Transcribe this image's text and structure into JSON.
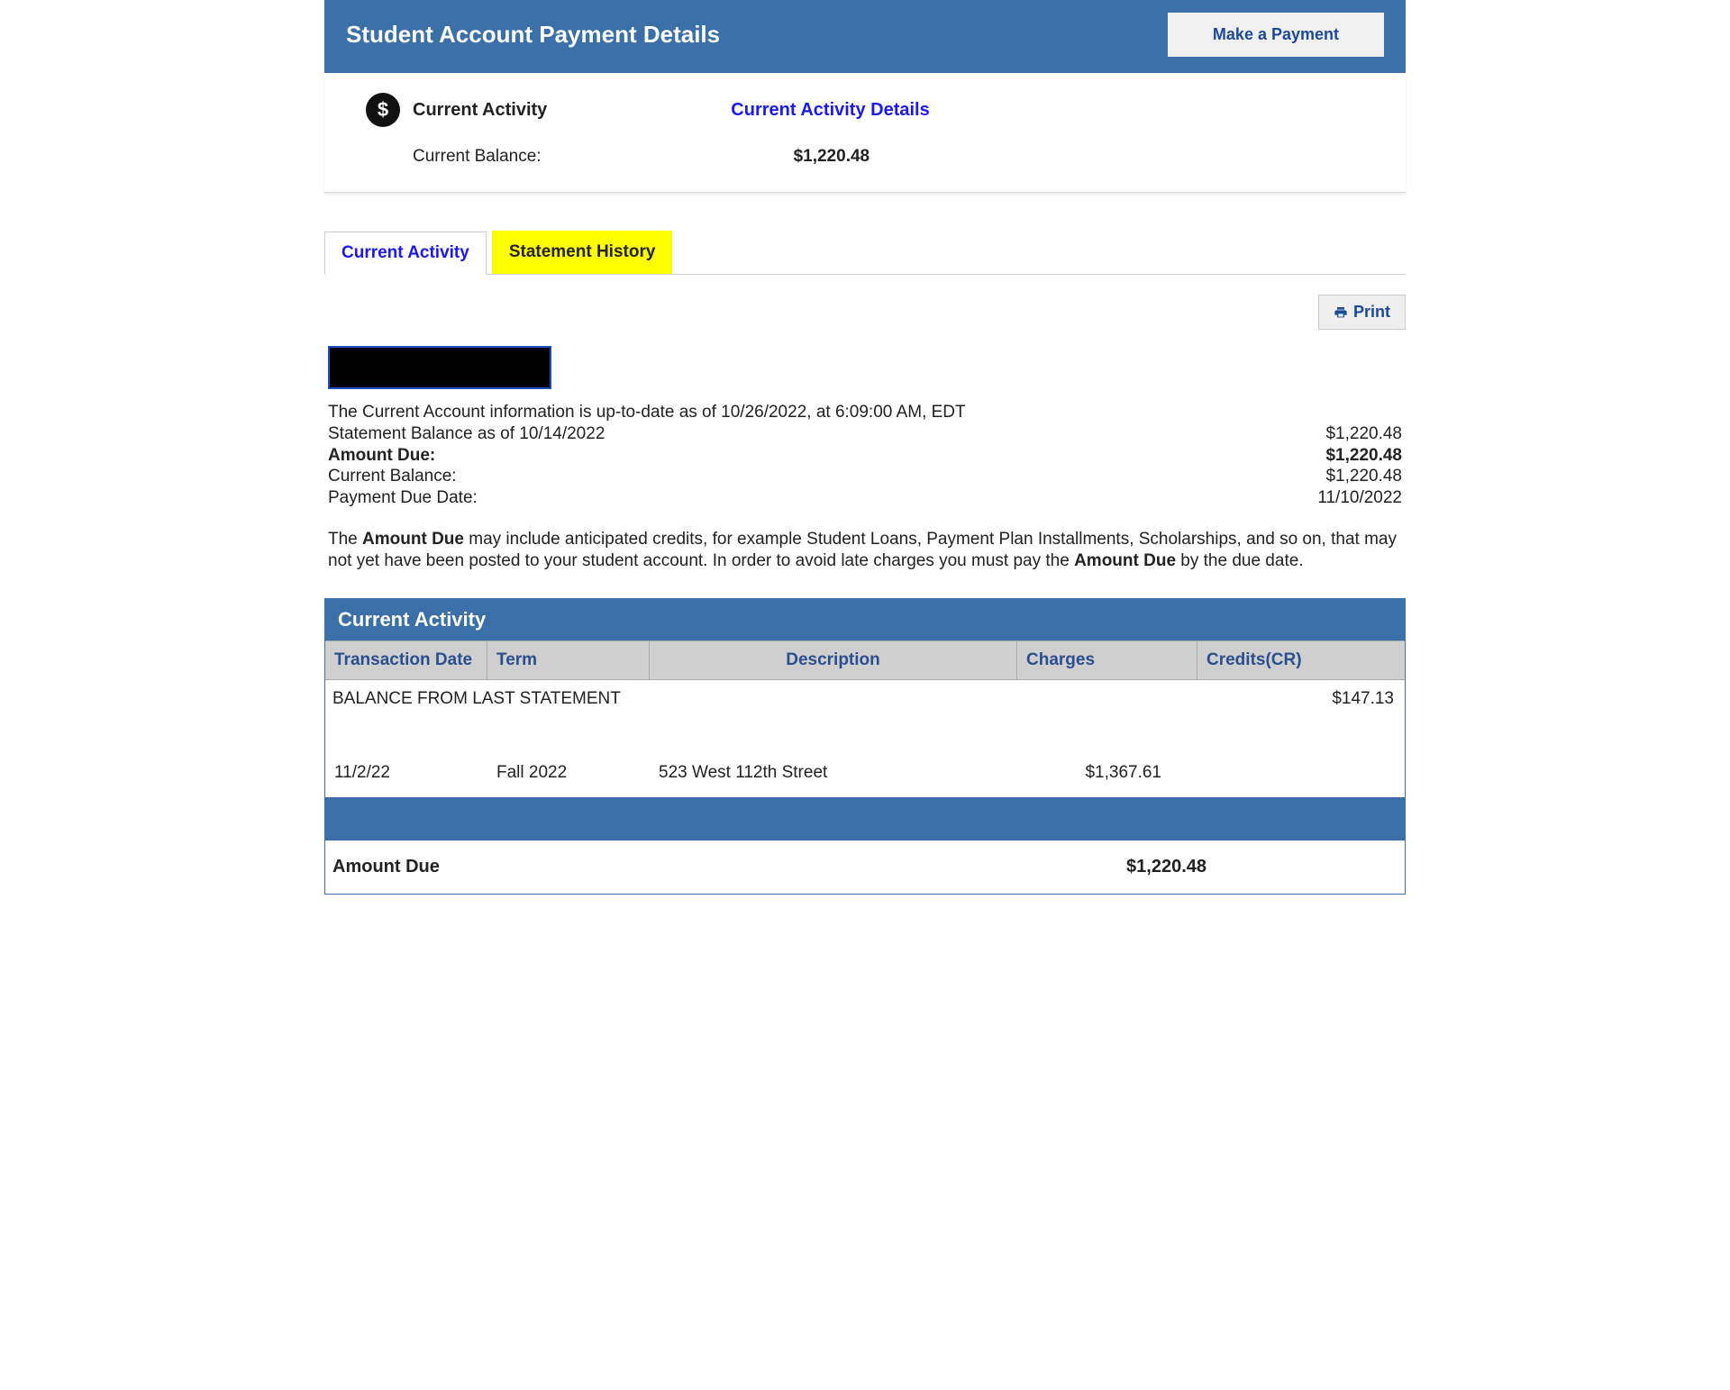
{
  "header": {
    "title": "Student Account Payment Details",
    "make_payment_label": "Make a Payment"
  },
  "summary": {
    "title": "Current Activity",
    "details_link": "Current Activity Details",
    "balance_label": "Current Balance:",
    "balance_value": "$1,220.48"
  },
  "tabs": {
    "current": "Current Activity",
    "history": "Statement History"
  },
  "print_label": "Print",
  "info": {
    "uptodate_line": "The Current Account information is up-to-date as of 10/26/2022, at 6:09:00 AM, EDT",
    "stmt_balance_label": "Statement Balance as of 10/14/2022",
    "stmt_balance_value": "$1,220.48",
    "amount_due_label": "Amount Due:",
    "amount_due_value": "$1,220.48",
    "current_balance_label": "Current Balance:",
    "current_balance_value": "$1,220.48",
    "payment_due_label": "Payment Due Date:",
    "payment_due_value": "11/10/2022"
  },
  "note": {
    "pre": "The ",
    "b1": "Amount Due",
    "mid": " may include anticipated credits, for example Student Loans, Payment Plan Installments, Scholarships, and so on, that may not yet have been posted to your student account. In order to avoid late charges you must pay the ",
    "b2": "Amount Due",
    "post": " by the due date."
  },
  "activity": {
    "section_title": "Current Activity",
    "headers": {
      "date": "Transaction Date",
      "term": "Term",
      "desc": "Description",
      "charges": "Charges",
      "credits": "Credits(CR)"
    },
    "balance_row_label": "BALANCE FROM LAST STATEMENT",
    "balance_row_value": "$147.13",
    "rows": [
      {
        "date": "11/2/22",
        "term": "Fall 2022",
        "desc": "523 West 112th Street",
        "charges": "$1,367.61",
        "credits": ""
      }
    ],
    "footer_label": "Amount Due",
    "footer_value": "$1,220.48"
  }
}
